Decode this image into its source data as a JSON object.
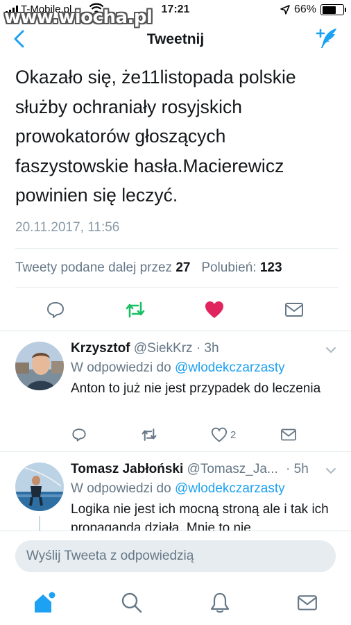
{
  "status_bar": {
    "carrier": "T-Mobile.pl",
    "watermark": "www.wiocha.pl",
    "time": "17:21",
    "battery": "66%",
    "battery_level": 0.66
  },
  "nav": {
    "title": "Tweetnij"
  },
  "tweet": {
    "text": "Okazało się, że11listopada polskie służby ochraniały rosyjskich prowokatorów głoszących faszystowskie hasła.Macierewicz powinien się leczyć.",
    "date": "20.11.2017, 11:56",
    "retweets_label": "Tweety podane dalej przez",
    "retweets_count": "27",
    "likes_label": "Polubień:",
    "likes_count": "123"
  },
  "replies": [
    {
      "name": "Krzysztof",
      "handle": "@SiekKrz",
      "time": "· 3h",
      "reply_to_label": "W odpowiedzi do",
      "reply_to_handle": "@wlodekczarzasty",
      "text": "Anton to już nie jest przypadek do leczenia",
      "likes": "2"
    },
    {
      "name": "Tomasz Jabłoński",
      "handle": "@Tomasz_Ja...",
      "time": "· 5h",
      "reply_to_label": "W odpowiedzi do",
      "reply_to_handle": "@wlodekczarzasty",
      "text": "Logika nie jest ich mocną stroną ale i tak ich propaganda działa. Mnie to nie"
    }
  ],
  "reply_bar": {
    "placeholder": "Wyślij Tweeta z odpowiedzią"
  },
  "colors": {
    "accent": "#1da1f2",
    "retweet": "#17bf63",
    "like": "#e0245e",
    "muted": "#657786"
  },
  "icons": [
    "back-icon",
    "compose-icon",
    "reply-icon",
    "retweet-icon",
    "heart-icon",
    "mail-icon",
    "chevron-down-icon",
    "home-icon",
    "search-icon",
    "bell-icon"
  ]
}
